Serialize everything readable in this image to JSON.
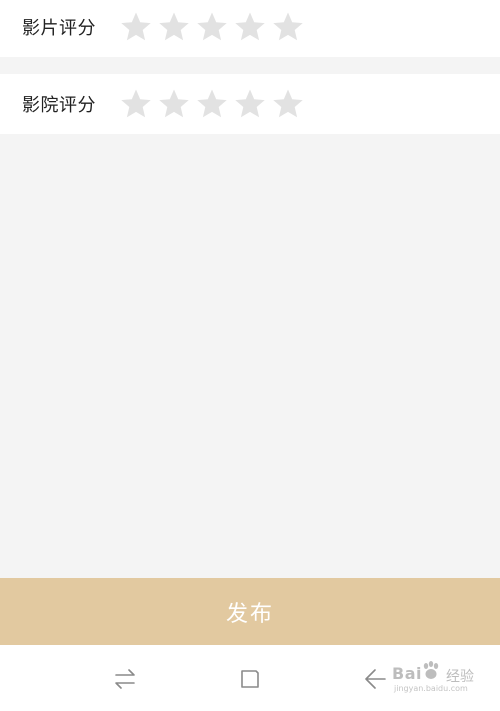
{
  "ratings": {
    "film": {
      "label": "影片评分",
      "stars_selected": 0,
      "stars_total": 5
    },
    "cinema": {
      "label": "影院评分",
      "stars_selected": 0,
      "stars_total": 5
    }
  },
  "publish": {
    "label": "发布"
  },
  "nav": {
    "recent_icon": "swap-arrows-icon",
    "home_icon": "square-home-icon",
    "back_icon": "back-arrow-icon"
  },
  "watermark": {
    "logo": "Bai",
    "logo_suffix": "经验",
    "url": "jingyan.baidu.com"
  },
  "colors": {
    "star_empty": "#e2e2e2",
    "publish_bg": "#e2c9a0",
    "page_bg": "#f4f4f4",
    "row_bg": "#ffffff",
    "nav_icon": "#8a8a8a"
  }
}
